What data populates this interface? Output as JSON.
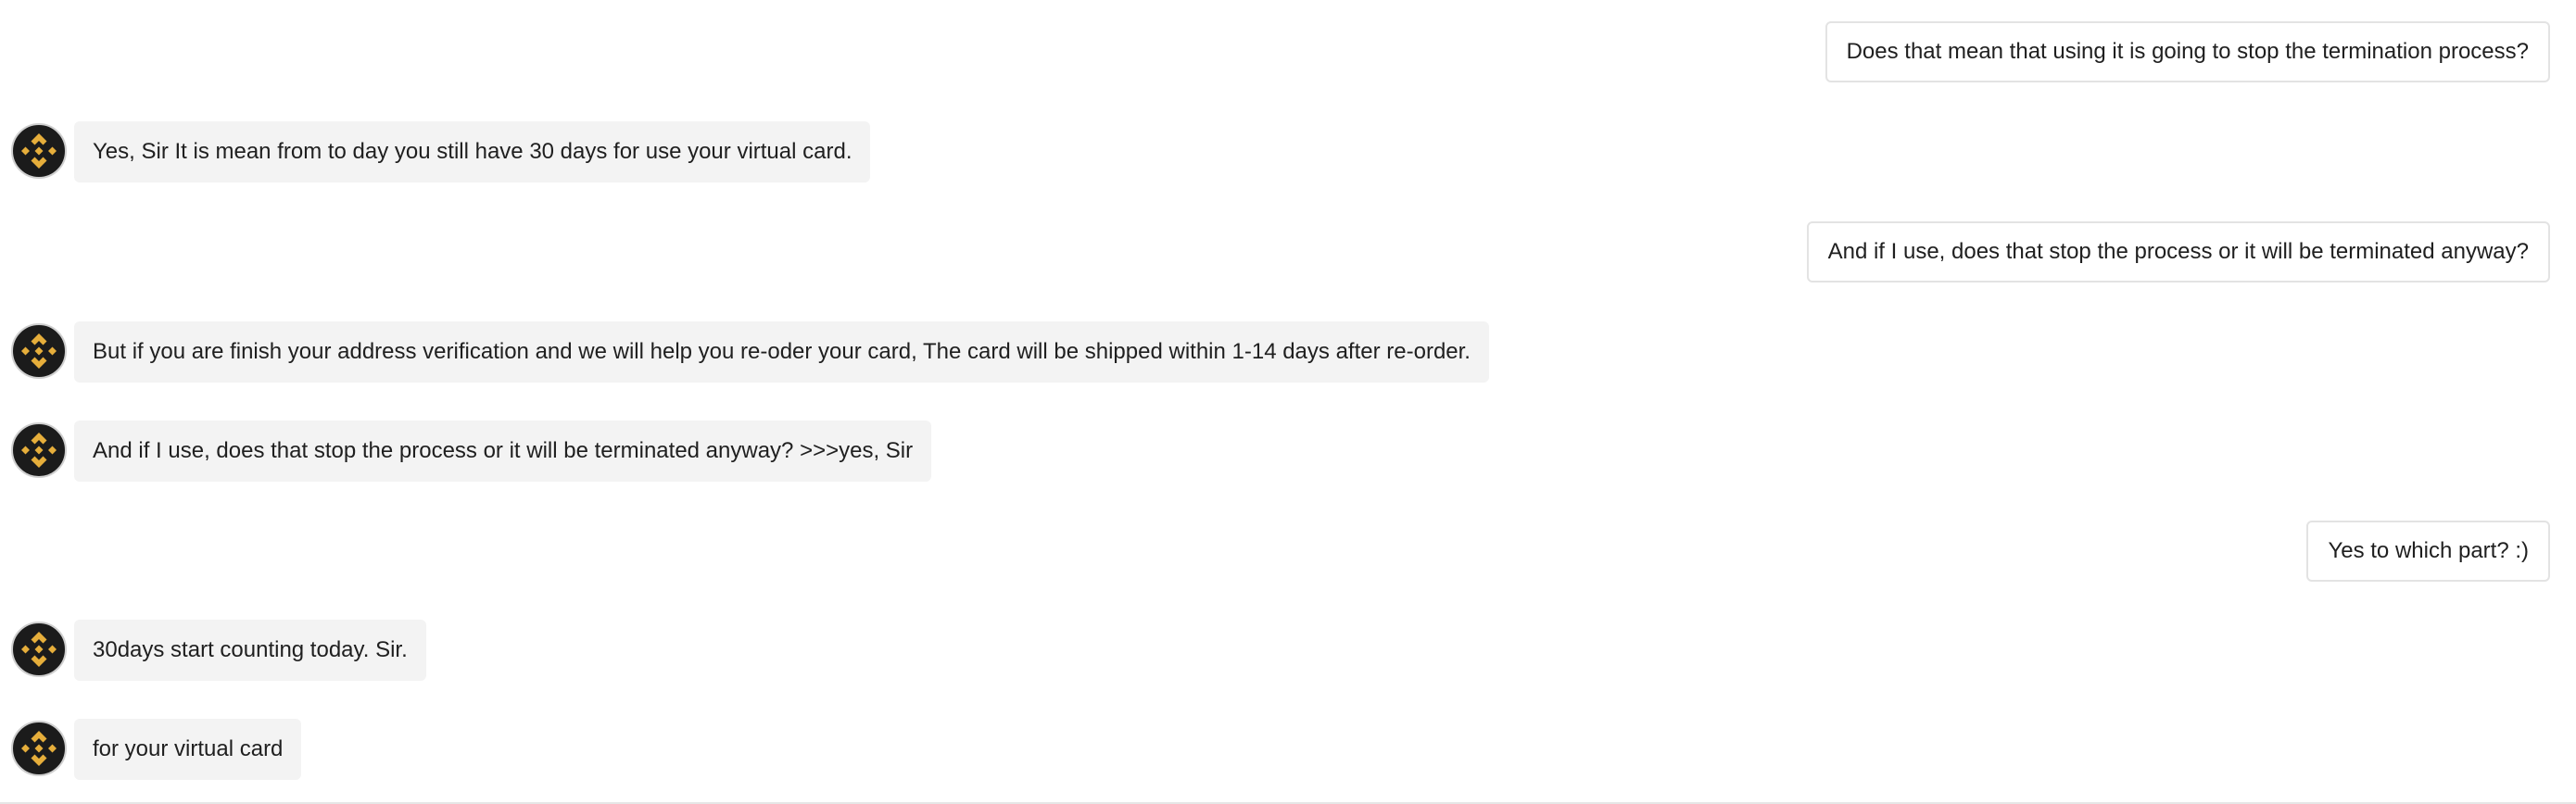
{
  "colors": {
    "bot_bubble_bg": "#f3f3f3",
    "user_bubble_border": "#e3e3e3",
    "avatar_bg": "#1b1b1b",
    "avatar_logo": "#e6ae3b"
  },
  "messages": [
    {
      "sender": "user",
      "text": "Does that mean that using it is going to stop the termination process?"
    },
    {
      "sender": "agent",
      "avatar_icon": "binance-logo-icon",
      "text": "Yes, Sir It is mean from to day you still have 30 days for use your virtual card."
    },
    {
      "sender": "user",
      "text": "And if I use, does that stop the process or it will be terminated anyway?"
    },
    {
      "sender": "agent",
      "avatar_icon": "binance-logo-icon",
      "text": "But if you are finish your address verification and we will help you re-oder your card, The card will be shipped within 1-14 days after re-order."
    },
    {
      "sender": "agent",
      "avatar_icon": "binance-logo-icon",
      "text": "And if I use, does that stop the process or it will be terminated anyway? >>>yes, Sir"
    },
    {
      "sender": "user",
      "text": "Yes to which part? :)"
    },
    {
      "sender": "agent",
      "avatar_icon": "binance-logo-icon",
      "text": "30days start counting today. Sir."
    },
    {
      "sender": "agent",
      "avatar_icon": "binance-logo-icon",
      "text": "for your virtual card"
    }
  ]
}
